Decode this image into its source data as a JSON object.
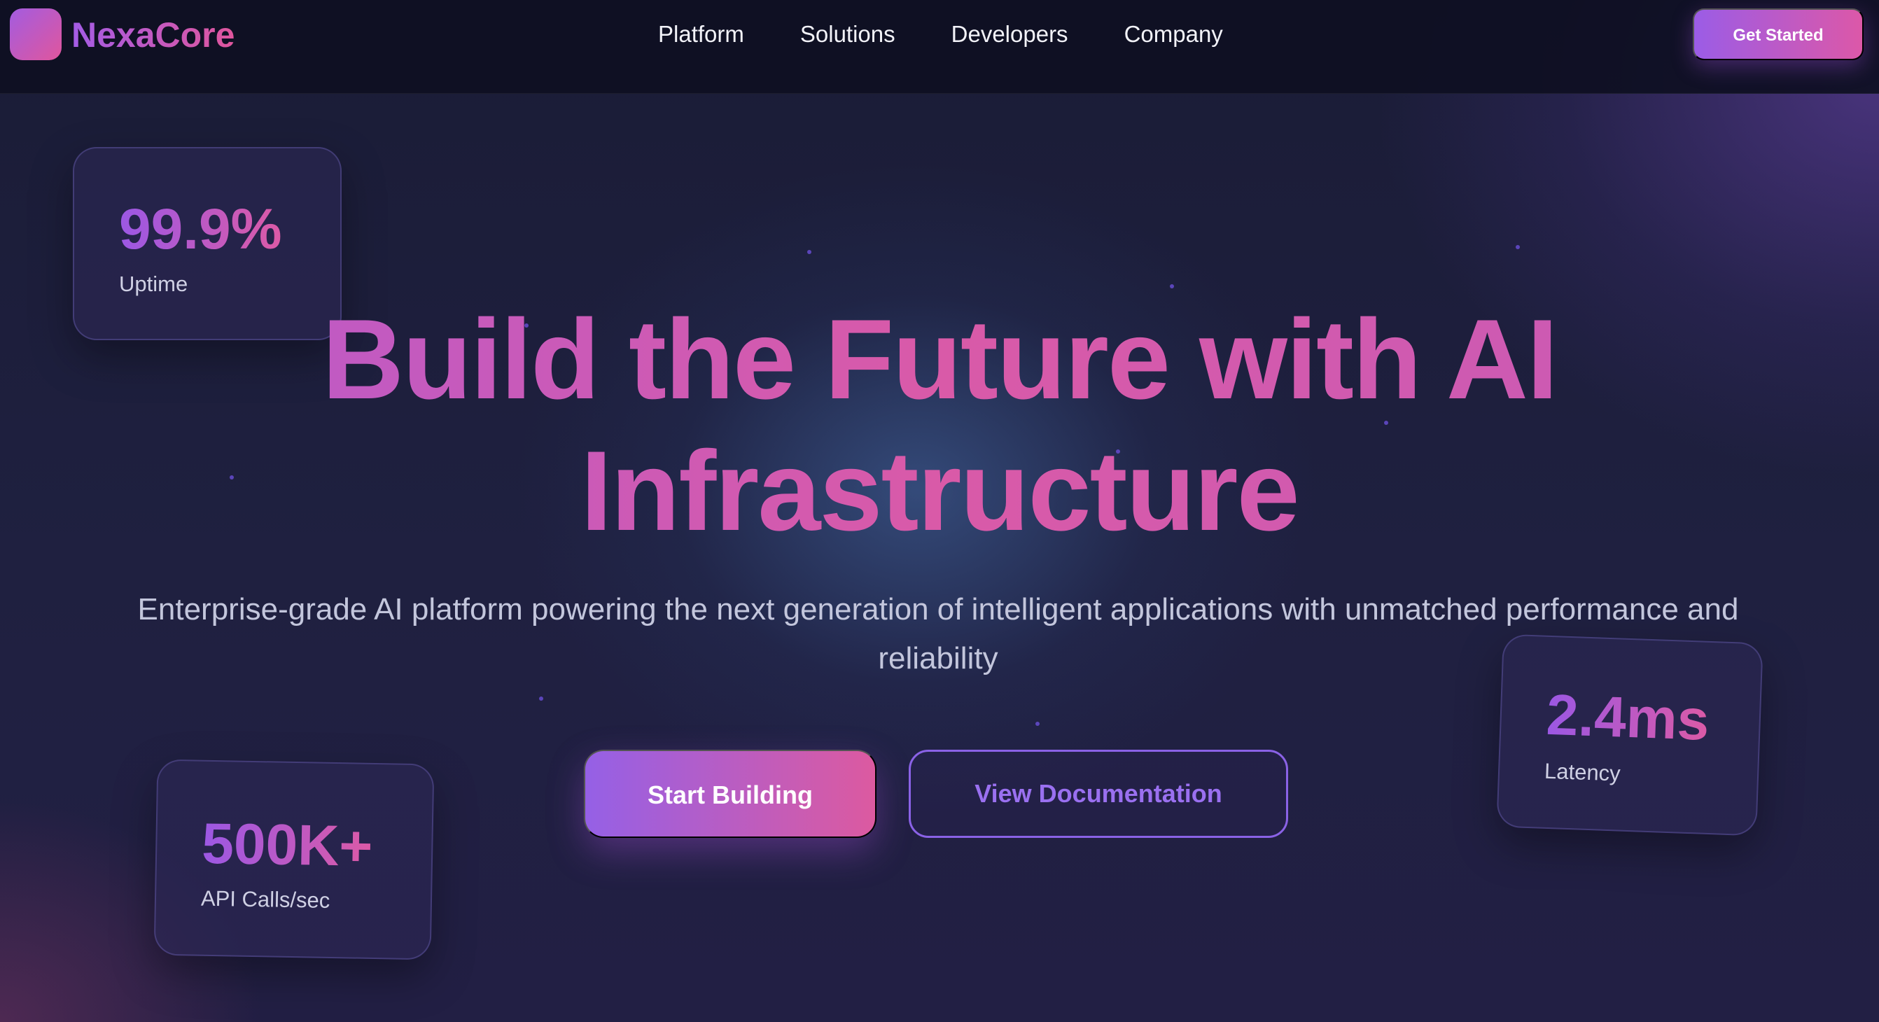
{
  "brand": {
    "name": "NexaCore"
  },
  "nav": {
    "links": [
      "Platform",
      "Solutions",
      "Developers",
      "Company"
    ],
    "cta_label": "Get Started"
  },
  "hero": {
    "title_line1": "Build the Future with AI",
    "title_line2": "Infrastructure",
    "subtitle_line1": "Enterprise-grade AI platform powering the next generation of intelligent applications with unmatched performance and",
    "subtitle_line2": "reliability",
    "primary_button": "Start Building",
    "secondary_button": "View Documentation"
  },
  "stats": [
    {
      "value": "99.9%",
      "label": "Uptime"
    },
    {
      "value": "2.4ms",
      "label": "Latency"
    },
    {
      "value": "500K+",
      "label": "API Calls/sec"
    }
  ],
  "colors": {
    "background": "#1c1d3a",
    "accent_purple": "#9b5ce6",
    "accent_pink": "#dc58a8"
  }
}
